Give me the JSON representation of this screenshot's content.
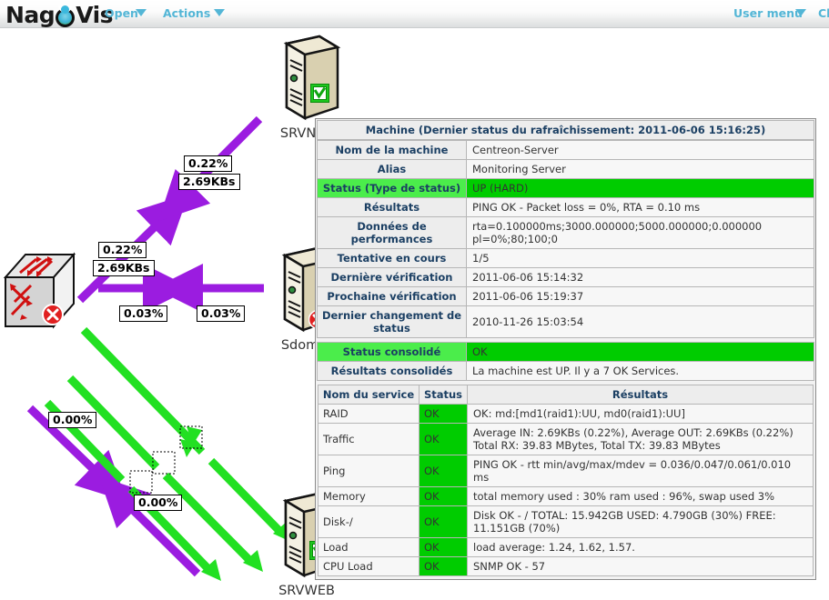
{
  "header": {
    "logo_text_left": "Nag",
    "logo_text_right": "Vis",
    "nav": [
      {
        "label": "Open",
        "caret": "chevron-down-icon"
      },
      {
        "label": "Actions",
        "caret": "chevron-down-icon"
      }
    ],
    "right_nav": [
      {
        "label": "User menu",
        "caret": "chevron-down-icon"
      },
      {
        "label": "Cl",
        "caret": null
      }
    ]
  },
  "map": {
    "nodes": [
      {
        "id": "srvnagios",
        "label": "SRVNAG",
        "state": "ok",
        "icon": "server-icon"
      },
      {
        "id": "sdomain",
        "label": "Sdomai",
        "state": "critical",
        "icon": "server-icon"
      },
      {
        "id": "srvweb",
        "label": "SRVWEB",
        "state": "ok",
        "icon": "server-icon"
      },
      {
        "id": "switch",
        "label": "",
        "state": "critical",
        "icon": "switch-icon"
      }
    ],
    "line_labels": [
      {
        "id": "l1-pct",
        "text": "0.22%"
      },
      {
        "id": "l1-rate",
        "text": "2.69KBs"
      },
      {
        "id": "l2-pct",
        "text": "0.22%"
      },
      {
        "id": "l2-rate",
        "text": "2.69KBs"
      },
      {
        "id": "l3-pct",
        "text": "0.03%"
      },
      {
        "id": "l4-pct",
        "text": "0.03%"
      },
      {
        "id": "l5-pct",
        "text": "0.00%"
      },
      {
        "id": "l6-pct",
        "text": "0.00%"
      }
    ],
    "colors": {
      "line_purple": "#9b1ce0",
      "line_green": "#22e022",
      "state_ok": "#00cc00",
      "state_critical": "#e02020"
    }
  },
  "tooltip": {
    "title": "Machine (Dernier status du rafraîchissement: 2011-06-06 15:16:25)",
    "rows": [
      {
        "key": "Nom de la machine",
        "value": "Centreon-Server",
        "state": null
      },
      {
        "key": "Alias",
        "value": "Monitoring Server",
        "state": null
      },
      {
        "key": "Status (Type de status)",
        "value": "UP (HARD)",
        "state": "ok"
      },
      {
        "key": "Résultats",
        "value": "PING OK - Packet loss = 0%, RTA = 0.10 ms",
        "state": null
      },
      {
        "key": "Données de performances",
        "value": "rta=0.100000ms;3000.000000;5000.000000;0.000000 pl=0%;80;100;0",
        "state": null
      },
      {
        "key": "Tentative en cours",
        "value": "1/5",
        "state": null
      },
      {
        "key": "Dernière vérification",
        "value": "2011-06-06 15:14:32",
        "state": null
      },
      {
        "key": "Prochaine vérification",
        "value": "2011-06-06 15:19:37",
        "state": null
      },
      {
        "key": "Dernier changement de status",
        "value": "2010-11-26 15:03:54",
        "state": null
      }
    ],
    "consolidated": [
      {
        "key": "Status consolidé",
        "value": "OK",
        "state": "ok"
      },
      {
        "key": "Résultats consolidés",
        "value": "La machine est UP. Il y a 7 OK Services.",
        "state": null
      }
    ],
    "services": {
      "columns": [
        "Nom du service",
        "Status",
        "Résultats"
      ],
      "rows": [
        {
          "name": "RAID",
          "status": "OK",
          "result": "OK: md:[md1(raid1):UU, md0(raid1):UU]"
        },
        {
          "name": "Traffic",
          "status": "OK",
          "result": "Average IN: 2.69KBs (0.22%), Average OUT: 2.69KBs (0.22%)\nTotal RX: 39.83 MBytes, Total TX: 39.83 MBytes"
        },
        {
          "name": "Ping",
          "status": "OK",
          "result": "PING OK - rtt min/avg/max/mdev = 0.036/0.047/0.061/0.010 ms"
        },
        {
          "name": "Memory",
          "status": "OK",
          "result": "total memory used : 30% ram used : 96%, swap used 3%"
        },
        {
          "name": "Disk-/",
          "status": "OK",
          "result": "Disk OK - / TOTAL: 15.942GB USED: 4.790GB (30%) FREE: 11.151GB (70%)"
        },
        {
          "name": "Load",
          "status": "OK",
          "result": "load average: 1.24, 1.62, 1.57."
        },
        {
          "name": "CPU Load",
          "status": "OK",
          "result": "SNMP OK - 57"
        }
      ]
    }
  }
}
